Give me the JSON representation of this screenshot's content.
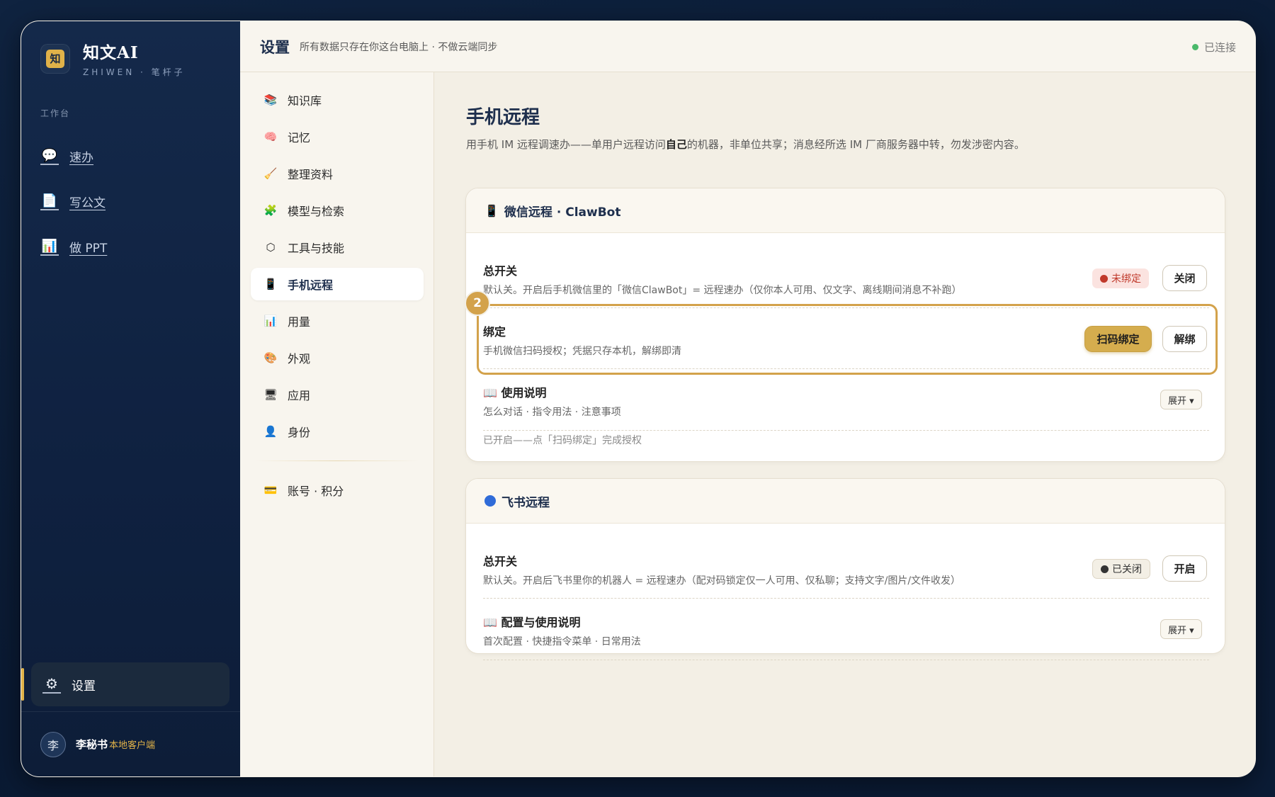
{
  "app": {
    "name": "知文AI",
    "subtitle": "ZHIWEN · 笔杆子",
    "logo_glyph": "知"
  },
  "sidebar": {
    "section_label": "工作台",
    "items": [
      {
        "label": "速办",
        "icon": "chat-bubble-icon"
      },
      {
        "label": "写公文",
        "icon": "document-icon"
      },
      {
        "label": "做 PPT",
        "icon": "bar-chart-icon"
      }
    ],
    "settings_label": "设置",
    "user": {
      "avatar": "李",
      "name": "李秘书",
      "tag": "本地客户端"
    }
  },
  "header": {
    "title": "设置",
    "subtitle": "所有数据只存在你这台电脑上 · 不做云端同步",
    "status": "已连接",
    "status_color": "#4ab96a"
  },
  "settings_nav": {
    "items": [
      {
        "label": "知识库",
        "icon": "books-icon",
        "glyph": "📚"
      },
      {
        "label": "记忆",
        "icon": "brain-icon",
        "glyph": "🧠"
      },
      {
        "label": "整理资料",
        "icon": "broom-icon",
        "glyph": "🧹"
      },
      {
        "label": "模型与检索",
        "icon": "puzzle-icon",
        "glyph": "🧩"
      },
      {
        "label": "工具与技能",
        "icon": "hexagon-icon",
        "glyph": "⬡"
      },
      {
        "label": "手机远程",
        "icon": "phone-icon",
        "glyph": "📱",
        "active": true
      },
      {
        "label": "用量",
        "icon": "bar-chart-icon",
        "glyph": "📊"
      },
      {
        "label": "外观",
        "icon": "palette-icon",
        "glyph": "🎨"
      },
      {
        "label": "应用",
        "icon": "monitor-icon",
        "glyph": "🖥"
      },
      {
        "label": "身份",
        "icon": "person-icon",
        "glyph": "👤"
      }
    ],
    "account": {
      "label": "账号 · 积分",
      "icon": "credit-card-icon",
      "glyph": "💳"
    }
  },
  "main": {
    "title": "手机远程",
    "desc_pre": "用手机 IM 远程调速办——单用户远程访问",
    "desc_bold": "自己",
    "desc_post": "的机器，非单位共享；消息经所选 IM 厂商服务器中转，勿发涉密内容。",
    "wechat": {
      "title": "微信远程 · ClawBot",
      "master": {
        "title": "总开关",
        "desc": "默认关。开启后手机微信里的「微信ClawBot」= 远程速办（仅你本人可用、仅文字、离线期间消息不补跑）",
        "status": "未绑定",
        "status_color": "#c0392b",
        "button": "关闭"
      },
      "bind": {
        "badge": "2",
        "title": "绑定",
        "desc": "手机微信扫码授权；凭据只存本机，解绑即清",
        "primary": "扫码绑定",
        "secondary": "解绑"
      },
      "guide": {
        "title": "使用说明",
        "desc": "怎么对话 · 指令用法 · 注意事项",
        "toggle": "展开 ▾"
      },
      "note": "已开启——点「扫码绑定」完成授权"
    },
    "feishu": {
      "title": "飞书远程",
      "master": {
        "title": "总开关",
        "desc": "默认关。开启后飞书里你的机器人 = 远程速办（配对码锁定仅一人可用、仅私聊；支持文字/图片/文件收发）",
        "status": "已关闭",
        "status_color": "#333333",
        "button": "开启"
      },
      "guide": {
        "title": "配置与使用说明",
        "desc": "首次配置 · 快捷指令菜单 · 日常用法",
        "toggle": "展开 ▾"
      }
    }
  },
  "colors": {
    "accent_gold": "#d5ad4e",
    "navy": "#1e2f4d"
  }
}
